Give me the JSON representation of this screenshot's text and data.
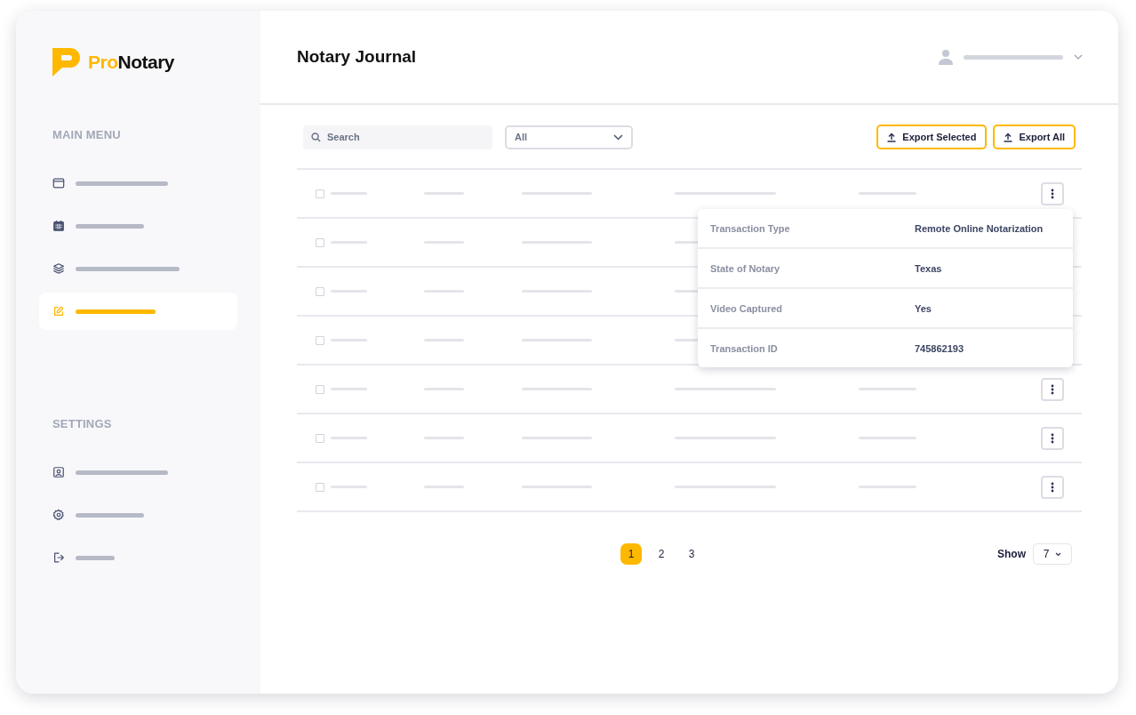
{
  "logo": {
    "highlight": "Pro",
    "rest": "Notary"
  },
  "sidebar": {
    "sections": [
      {
        "heading": "MAIN MENU",
        "items": [
          {
            "selected": false
          },
          {
            "selected": false
          },
          {
            "selected": false
          },
          {
            "selected": true
          }
        ]
      },
      {
        "heading": "SETTINGS",
        "items": [
          {
            "selected": false
          },
          {
            "selected": false
          },
          {
            "selected": false
          }
        ]
      }
    ]
  },
  "header": {
    "title": "Notary Journal"
  },
  "toolbar": {
    "search": {
      "placeholder": "Search"
    },
    "filter": {
      "value": "All"
    },
    "buttons": [
      "Export Selected",
      "Export All"
    ]
  },
  "rows": [
    {
      "checked": false,
      "details": [
        {
          "label": "Transaction Type",
          "value": "Remote Online Notarization"
        },
        {
          "label": "State of Notary",
          "value": "Texas"
        },
        {
          "label": "Video Captured",
          "value": "Yes"
        },
        {
          "label": "Transaction ID",
          "value": "745862193"
        }
      ]
    },
    {
      "checked": false
    },
    {
      "checked": false
    },
    {
      "checked": false
    },
    {
      "checked": false
    },
    {
      "checked": false
    },
    {
      "checked": false
    }
  ],
  "pagination": {
    "pages": [
      {
        "label": "1",
        "selected": true
      },
      {
        "label": "2",
        "selected": false
      },
      {
        "label": "3",
        "selected": false
      }
    ],
    "show_label": "Show",
    "show_value": "7"
  }
}
